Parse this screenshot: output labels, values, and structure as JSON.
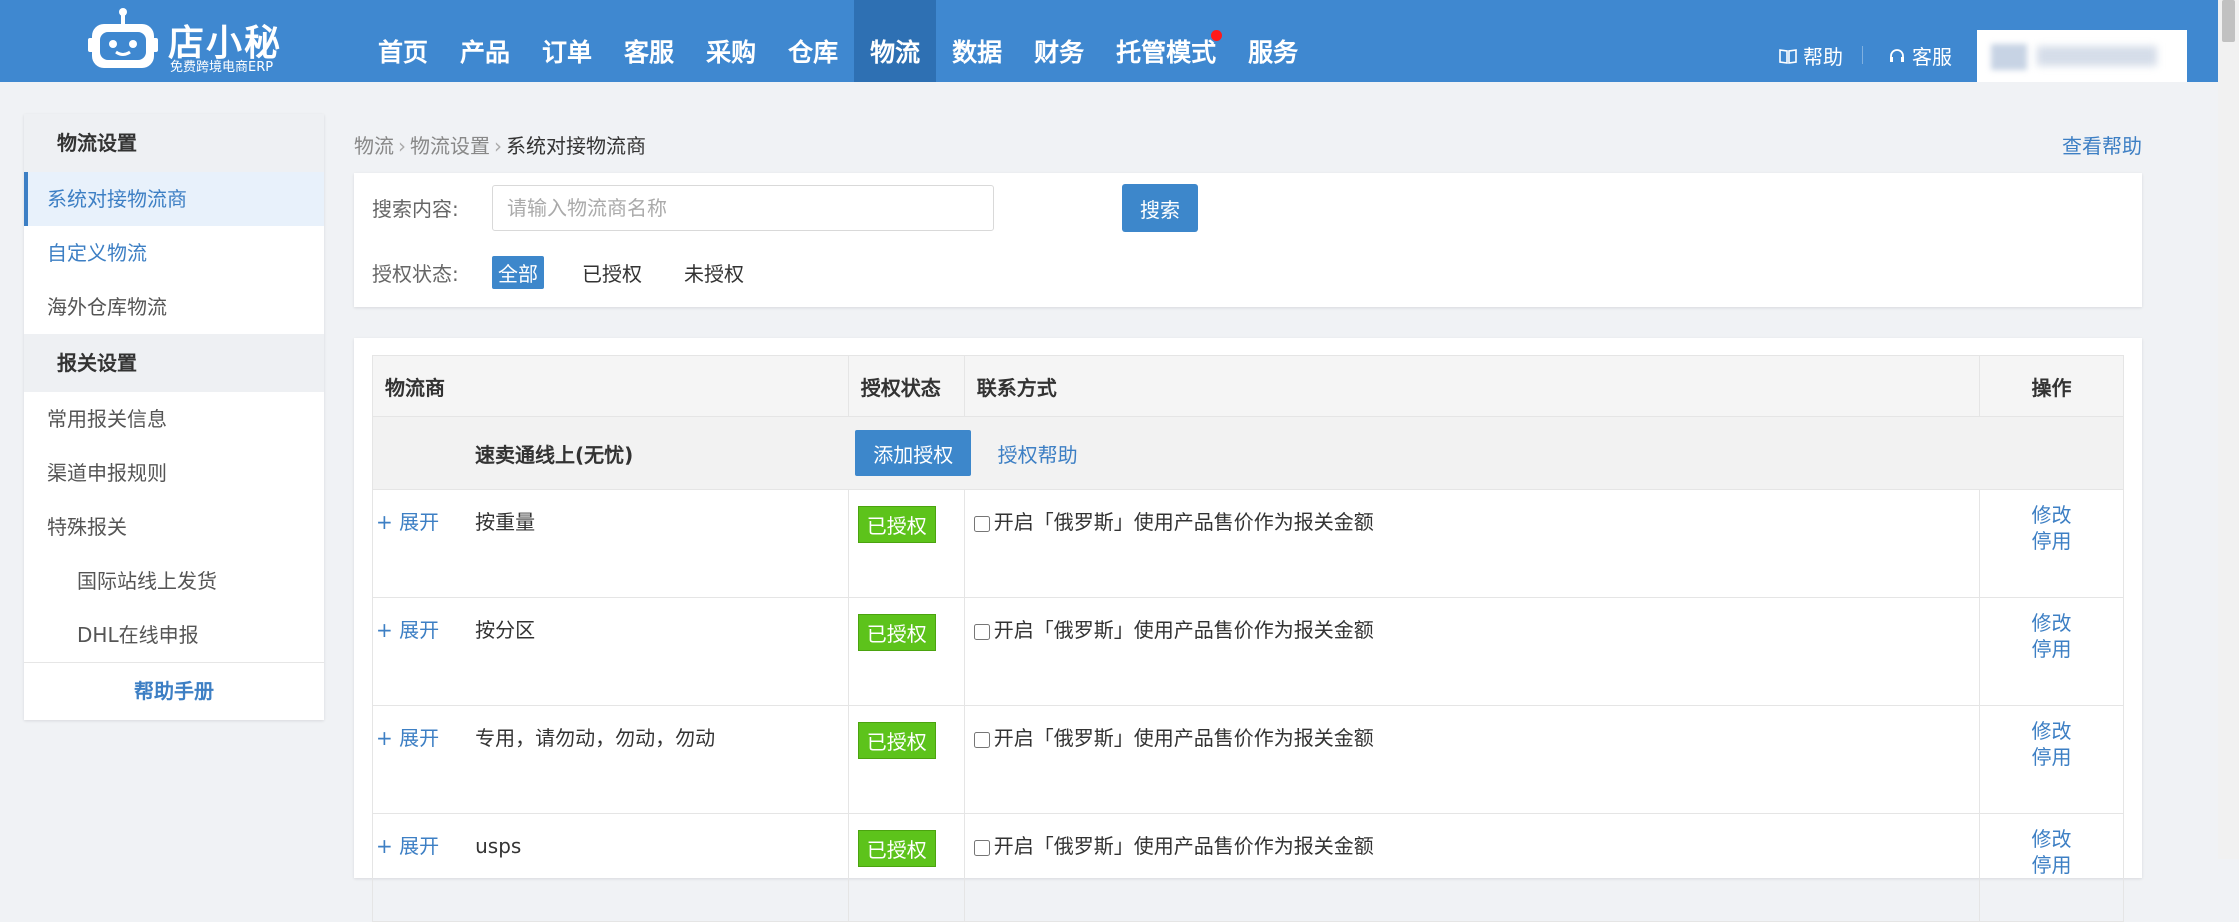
{
  "header": {
    "logo_name": "店小秘",
    "logo_slogan": "免费跨境电商ERP",
    "nav": [
      "首页",
      "产品",
      "订单",
      "客服",
      "采购",
      "仓库",
      "物流",
      "数据",
      "财务",
      "托管模式",
      "服务"
    ],
    "active_nav": "物流",
    "help_label": "帮助",
    "cs_label": "客服"
  },
  "sidebar": {
    "section1": "物流设置",
    "items1": [
      "系统对接物流商",
      "自定义物流",
      "海外仓库物流"
    ],
    "section2": "报关设置",
    "items2": [
      "常用报关信息",
      "渠道申报规则",
      "特殊报关"
    ],
    "subitems": [
      "国际站线上发货",
      "DHL在线申报"
    ],
    "footer": "帮助手册"
  },
  "breadcrumb": {
    "items": [
      "物流",
      "物流设置",
      "系统对接物流商"
    ],
    "view_help": "查看帮助"
  },
  "search": {
    "label": "搜索内容:",
    "placeholder": "请输入物流商名称",
    "button": "搜索",
    "auth_label": "授权状态:",
    "auth_options": [
      "全部",
      "已授权",
      "未授权"
    ],
    "auth_selected": "全部"
  },
  "table": {
    "headers": [
      "物流商",
      "授权状态",
      "联系方式",
      "操作"
    ],
    "group": {
      "name": "速卖通线上(无忧)",
      "add_button": "添加授权",
      "help_link": "授权帮助"
    },
    "rows": [
      {
        "expand": "+ 展开",
        "name": "按重量",
        "status": "已授权",
        "contact": "开启「俄罗斯」使用产品售价作为报关金额",
        "ops": [
          "修改",
          "停用"
        ]
      },
      {
        "expand": "+ 展开",
        "name": "按分区",
        "status": "已授权",
        "contact": "开启「俄罗斯」使用产品售价作为报关金额",
        "ops": [
          "修改",
          "停用"
        ]
      },
      {
        "expand": "+ 展开",
        "name": "专用，请勿动，勿动，勿动",
        "status": "已授权",
        "contact": "开启「俄罗斯」使用产品售价作为报关金额",
        "ops": [
          "修改",
          "停用"
        ]
      },
      {
        "expand": "+ 展开",
        "name": "usps",
        "status": "已授权",
        "contact": "开启「俄罗斯」使用产品售价作为报关金额",
        "ops": [
          "修改",
          "停用"
        ]
      }
    ]
  }
}
